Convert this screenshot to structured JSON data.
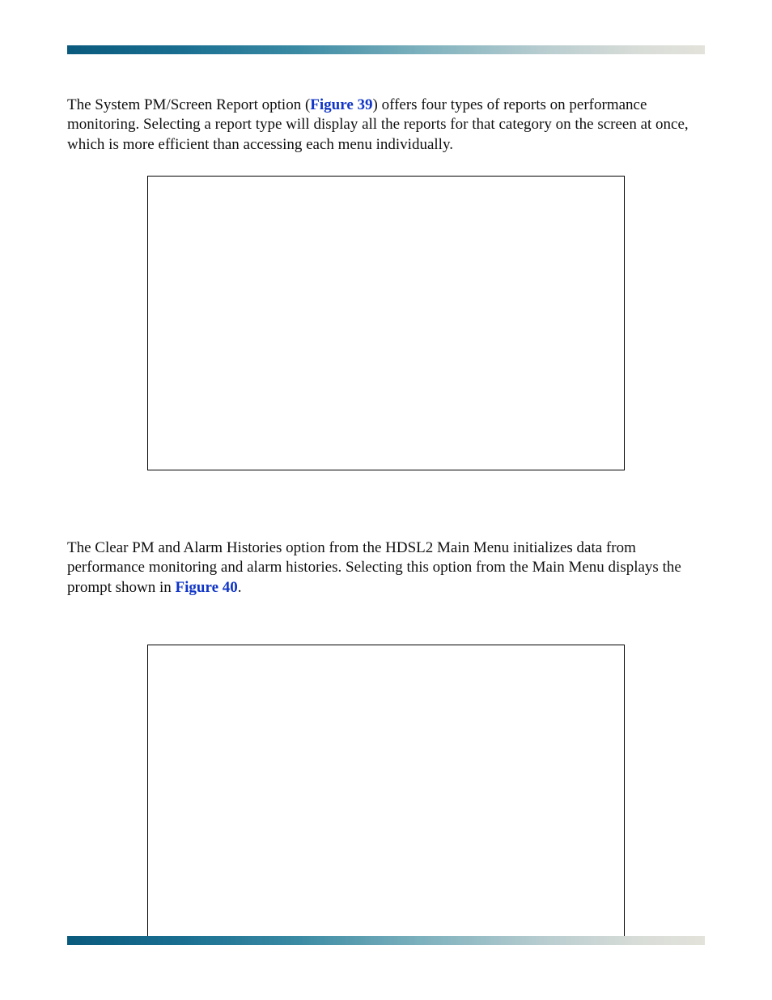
{
  "para1": {
    "pre": "The System PM/Screen Report option (",
    "link": "Figure 39",
    "post": ") offers four types of reports on performance monitoring. Selecting a report type will display all the reports for that category on the screen at once, which is more efficient than accessing each menu individually."
  },
  "para2": {
    "pre": "The Clear PM and Alarm Histories option from the HDSL2 Main Menu initializes data from performance monitoring and alarm histories. Selecting this option from the Main Menu displays the prompt shown in ",
    "link": "Figure 40",
    "post": "."
  }
}
